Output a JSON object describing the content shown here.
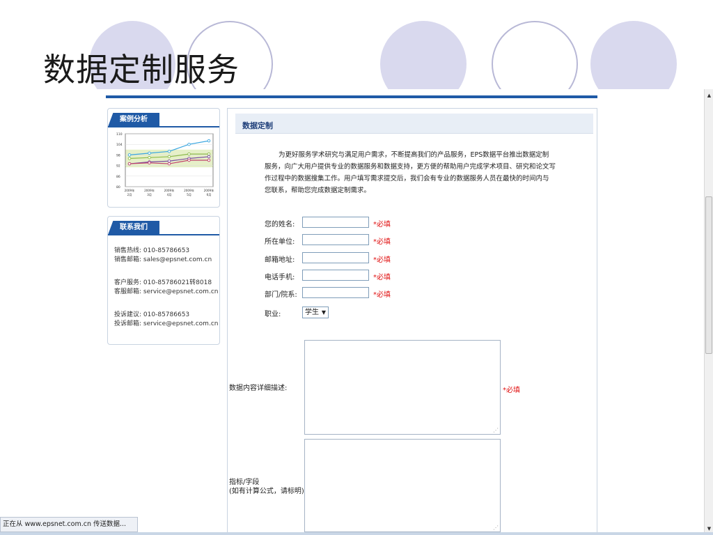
{
  "slide": {
    "title": "数据定制服务"
  },
  "sidebar": {
    "case_panel": {
      "tab_label": "案例分析",
      "chart_data": {
        "type": "line",
        "categories": [
          "2009年\n2月",
          "2009年\n3月",
          "2009年\n4月",
          "2009年\n5月",
          "2009年\n6月"
        ],
        "x_labels_line1": [
          "2009年",
          "2009年",
          "2009年",
          "2009年",
          "2009年"
        ],
        "x_labels_line2": [
          "2月",
          "3月",
          "4月",
          "5月",
          "6月"
        ],
        "y_ticks": [
          "110",
          "104",
          "98",
          "92",
          "86",
          "80"
        ],
        "ylim": [
          80,
          110
        ],
        "series": [
          {
            "values": [
              98,
              99,
              100,
              104,
              106
            ],
            "color": "#3aa6e0"
          },
          {
            "values": [
              96,
              96.5,
              97,
              98.5,
              98.5
            ],
            "color": "#8dbb4a"
          },
          {
            "values": [
              93,
              94,
              94.5,
              96,
              97
            ],
            "color": "#7a4aa0"
          },
          {
            "values": [
              93,
              93.5,
              93,
              95,
              95
            ],
            "color": "#c0406a"
          }
        ]
      }
    },
    "contact_panel": {
      "tab_label": "联系我们",
      "lines": [
        {
          "label": "销售热线:",
          "value": "010-85786653"
        },
        {
          "label": "销售邮箱:",
          "value": "sales@epsnet.com.cn"
        },
        {
          "label": "客户服务:",
          "value": "010-85786021转8018"
        },
        {
          "label": "客服邮箱:",
          "value": "service@epsnet.com.cn"
        },
        {
          "label": "投诉建议:",
          "value": "010-85786653"
        },
        {
          "label": "投诉邮箱:",
          "value": "service@epsnet.com.cn"
        }
      ]
    }
  },
  "main": {
    "section_title": "数据定制",
    "intro_line1": "为更好服务学术研究与满足用户需求，不断提高我们的产品服务，EPS数据平台推出数据定制",
    "intro_line2": "服务，向广大用户提供专业的数据服务和数据支持，更方便的帮助用户完成学术项目、研究和论文写",
    "intro_line3": "作过程中的数据搜集工作。用户填写需求提交后，我们会有专业的数据服务人员在最快的时间内与",
    "intro_line4": "您联系，帮助您完成数据定制需求。",
    "form": {
      "name_label": "您的姓名:",
      "name_value": "",
      "unit_label": "所在单位:",
      "unit_value": "",
      "email_label": "邮箱地址:",
      "email_value": "",
      "phone_label": "电话手机:",
      "phone_value": "",
      "dept_label": "部门/院系:",
      "dept_value": "",
      "required_mark": "*必填",
      "job_label": "职业:",
      "job_selected": "学生",
      "desc_label": "数据内容详细描述:",
      "index_label_line1": "指标/字段",
      "index_label_line2": "(如有计算公式，请标明)"
    }
  },
  "statusbar": {
    "text": "正在从 www.epsnet.com.cn 传送数据..."
  },
  "colors": {
    "accent": "#1f5aa6",
    "required": "#e01010",
    "circle_fill": "#d9d9ee"
  }
}
